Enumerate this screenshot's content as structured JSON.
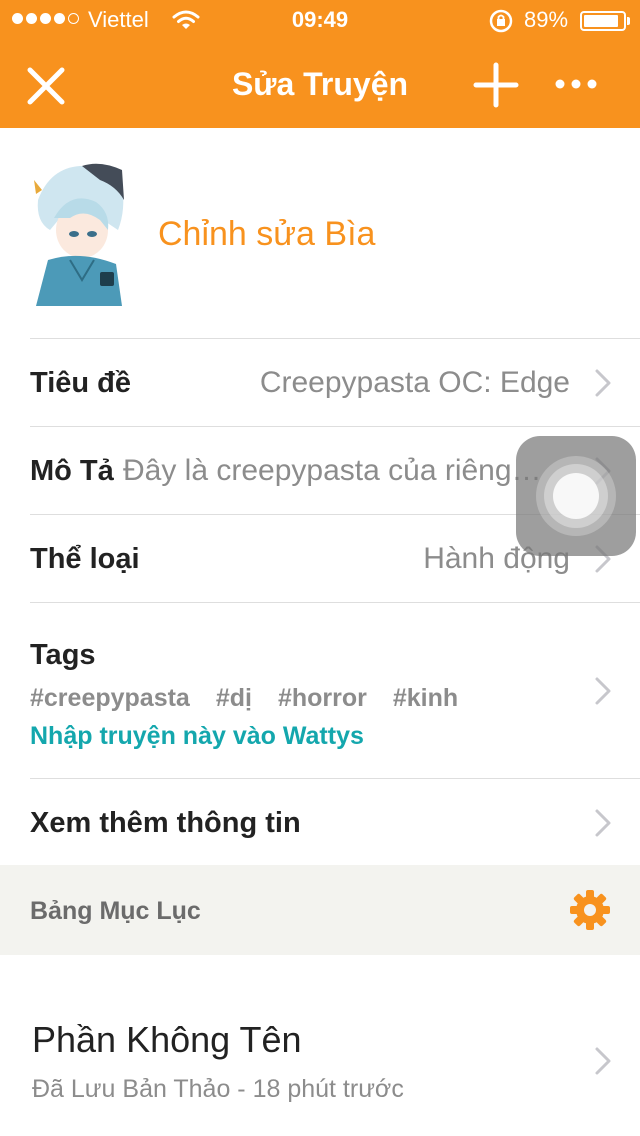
{
  "status_bar": {
    "carrier": "Viettel",
    "time": "09:49",
    "battery": "89%",
    "battery_level": 0.89,
    "signal_bars_filled": 4,
    "signal_bars_total": 5
  },
  "nav": {
    "title": "Sửa Truyện",
    "close_icon": "close-icon",
    "add_icon": "plus-icon",
    "more_icon": "more-icon"
  },
  "cover": {
    "edit_label": "Chỉnh sửa Bìa"
  },
  "fields": {
    "title": {
      "label": "Tiêu đề",
      "value": "Creepypasta OC: Edge"
    },
    "description": {
      "label": "Mô Tả",
      "value": "Đây là creepypasta của riêng…"
    },
    "genre": {
      "label": "Thể loại",
      "value": "Hành động"
    },
    "tags": {
      "label": "Tags",
      "items": [
        "#creepypasta",
        "#dị",
        "#horror",
        "#kinh"
      ],
      "wattys_link": "Nhập truyện này vào Wattys"
    },
    "more_info": {
      "label": "Xem thêm thông tin"
    }
  },
  "toc": {
    "label": "Bảng Mục Lục",
    "parts": [
      {
        "title": "Phần Không Tên",
        "subtitle": "Đã Lưu Bản Thảo - 18 phút trước"
      }
    ]
  },
  "colors": {
    "accent": "#f8921e",
    "link": "#14a7ad",
    "muted": "#8c8c8c"
  }
}
